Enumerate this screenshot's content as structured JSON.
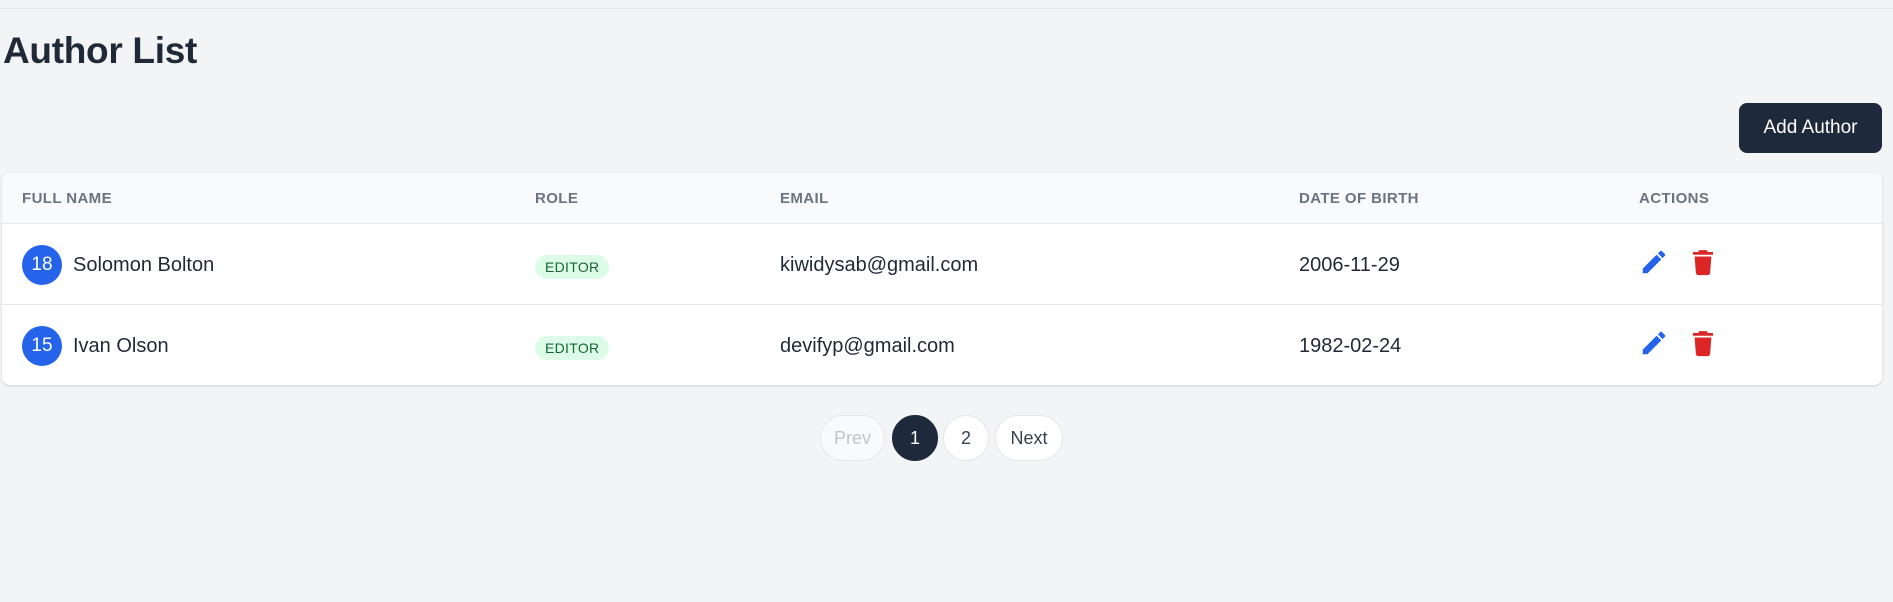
{
  "page": {
    "title": "Author List",
    "add_button_label": "Add Author"
  },
  "table": {
    "headers": {
      "full_name": "FULL NAME",
      "role": "ROLE",
      "email": "EMAIL",
      "dob": "DATE OF BIRTH",
      "actions": "ACTIONS"
    },
    "rows": [
      {
        "avatar": "18",
        "name": "Solomon Bolton",
        "role": "EDITOR",
        "email": "kiwidysab@gmail.com",
        "dob": "2006-11-29"
      },
      {
        "avatar": "15",
        "name": "Ivan Olson",
        "role": "EDITOR",
        "email": "devifyp@gmail.com",
        "dob": "1982-02-24"
      }
    ],
    "icons": {
      "edit": "pencil-icon",
      "delete": "trash-icon"
    }
  },
  "pagination": {
    "prev": "Prev",
    "pages": [
      "1",
      "2"
    ],
    "current_page": "1",
    "next": "Next"
  },
  "colors": {
    "accent": "#2563eb",
    "primary_dark": "#1e293b",
    "danger": "#dc2626",
    "badge_bg": "#dcfce7",
    "badge_text": "#166534"
  }
}
